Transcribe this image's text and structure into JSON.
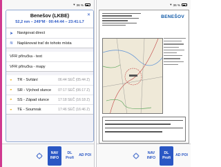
{
  "left_screen": {
    "status_bar": {
      "right": "36 %"
    },
    "popup": {
      "title": "Benešov (LKBE)",
      "subtitle": "52,2 nm – 249°M · 00:44:44 – 23:41:L7",
      "close_icon": "close-icon",
      "actions": [
        {
          "icon": "navigate-icon",
          "label": "Navigovat direct"
        },
        {
          "icon": "route-icon",
          "label": "Naplánovat trať do tohoto místa"
        }
      ],
      "guides": [
        {
          "label": "VFR příručka - text"
        },
        {
          "label": "VFR příručka - mapy"
        }
      ],
      "times": [
        {
          "icon": "twilight-dawn-icon",
          "label": "TR - Svítání",
          "value": "06:44 SEČ (05:44 Z)"
        },
        {
          "icon": "sunrise-icon",
          "label": "SR - Východ slunce",
          "value": "07:17 SEČ (06:17 Z)"
        },
        {
          "icon": "sunset-icon",
          "label": "SS - Západ slunce",
          "value": "17:18 SEČ (16:18 Z)"
        },
        {
          "icon": "twilight-dusk-icon",
          "label": "TE - Soumrak",
          "value": "17:46 SEČ (16:46 Z)"
        }
      ]
    },
    "bottom_nav": {
      "target_icon": "crosshair-icon",
      "buttons": [
        {
          "label": "NAV INFO",
          "active": true
        },
        {
          "label": "DL Profi",
          "active": false
        },
        {
          "label": "AD POI",
          "active": false
        }
      ]
    }
  },
  "right_screen": {
    "status_bar": {
      "right": "36 %"
    },
    "chart": {
      "title": "BENEŠOV"
    },
    "bottom_nav": {
      "target_icon": "crosshair-icon",
      "buttons": [
        {
          "label": "NAV INFO",
          "active": false
        },
        {
          "label": "DL Profi",
          "active": true
        },
        {
          "label": "AD POI",
          "active": false
        }
      ]
    }
  },
  "colors": {
    "accent": "#2a57c4",
    "highlight": "#d0398f",
    "sun_icon": "#e6a800"
  }
}
